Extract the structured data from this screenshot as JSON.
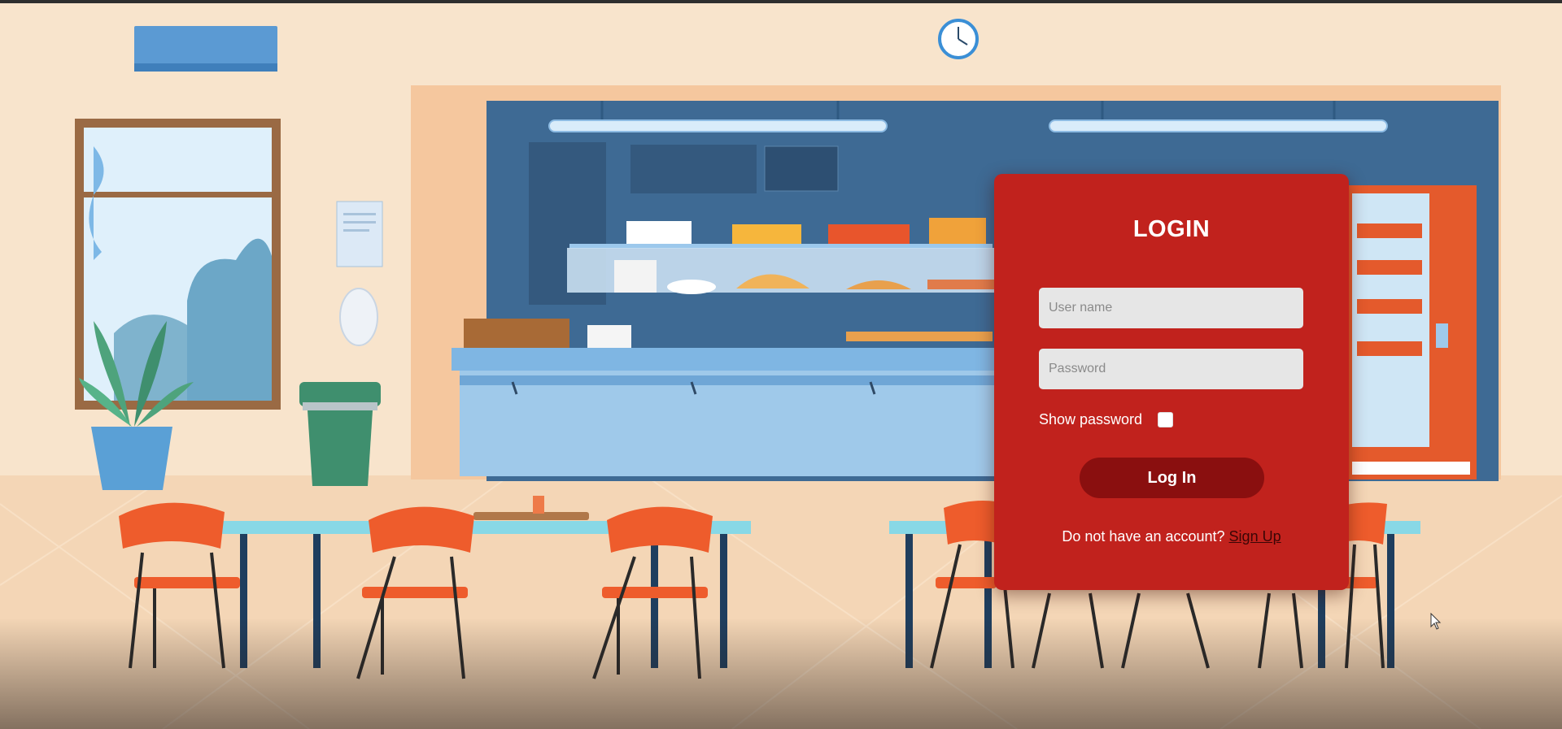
{
  "login": {
    "title": "LOGIN",
    "username_placeholder": "User name",
    "username_value": "",
    "password_placeholder": "Password",
    "password_value": "",
    "show_password_label": "Show password",
    "show_password_checked": false,
    "login_button": "Log In",
    "signup_prompt": "Do not have an account?",
    "signup_link": "Sign Up"
  },
  "colors": {
    "card": "#c1221d",
    "button": "#8a0f0f",
    "input": "#e6e6e6",
    "wall": "#f8e4cc",
    "kitchen": "#3e6a94"
  },
  "icons": [
    "clock-icon",
    "mouse-cursor-icon"
  ]
}
